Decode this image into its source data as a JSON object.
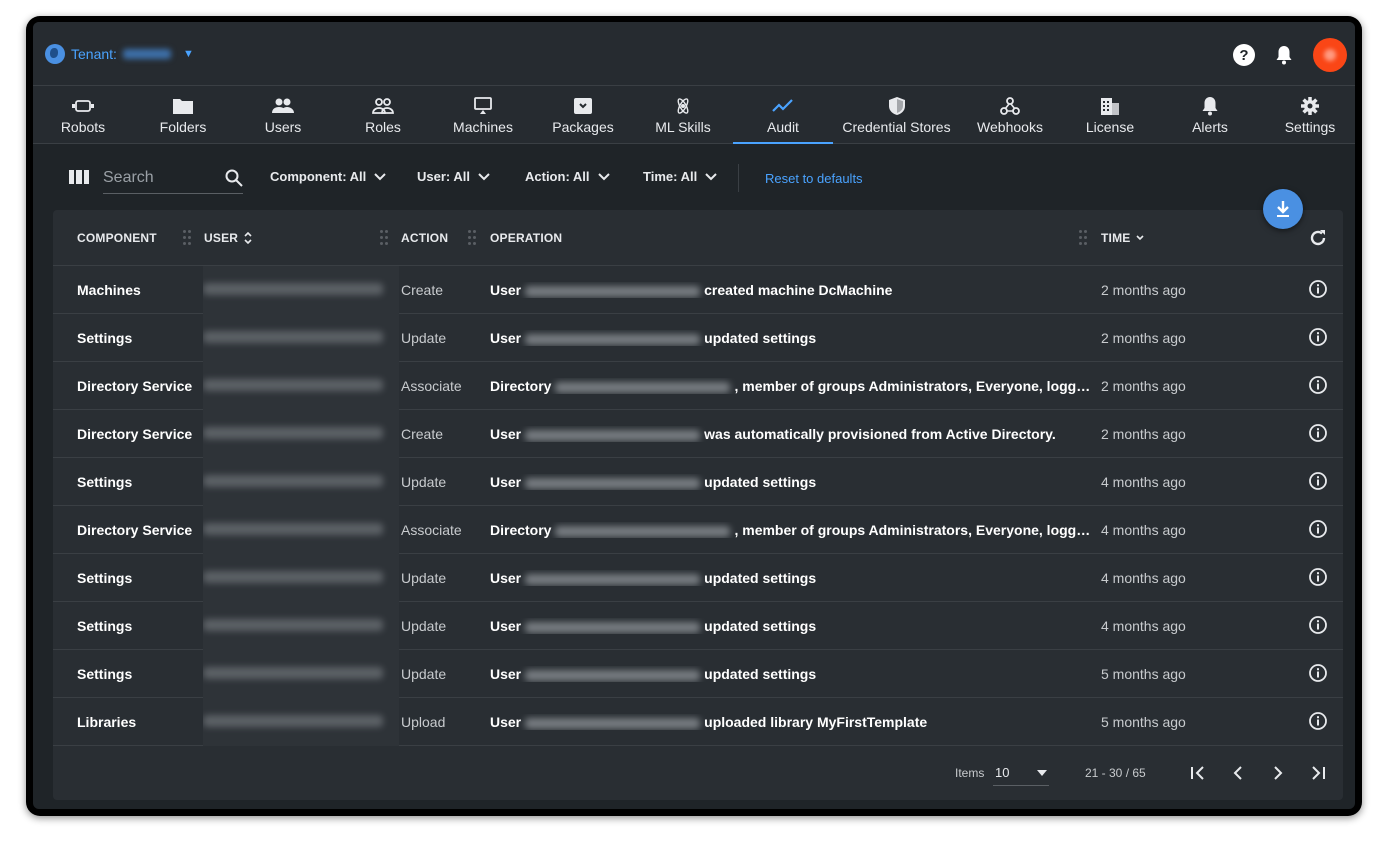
{
  "topbar": {
    "tenant_label": "Tenant:",
    "tenant_name_blurred": "Entities"
  },
  "nav": [
    {
      "label": "Robots",
      "icon": "robot-icon"
    },
    {
      "label": "Folders",
      "icon": "folder-icon"
    },
    {
      "label": "Users",
      "icon": "users-icon"
    },
    {
      "label": "Roles",
      "icon": "roles-icon"
    },
    {
      "label": "Machines",
      "icon": "machine-icon"
    },
    {
      "label": "Packages",
      "icon": "package-icon"
    },
    {
      "label": "ML Skills",
      "icon": "ml-skills-icon"
    },
    {
      "label": "Audit",
      "icon": "audit-icon",
      "active": true
    },
    {
      "label": "Credential Stores",
      "icon": "shield-icon"
    },
    {
      "label": "Webhooks",
      "icon": "webhook-icon"
    },
    {
      "label": "License",
      "icon": "license-icon"
    },
    {
      "label": "Alerts",
      "icon": "bell-icon"
    },
    {
      "label": "Settings",
      "icon": "gear-icon"
    }
  ],
  "filters": {
    "search_placeholder": "Search",
    "component": "Component: All",
    "user": "User: All",
    "action": "Action: All",
    "time": "Time: All",
    "reset": "Reset to defaults"
  },
  "table": {
    "headers": {
      "component": "COMPONENT",
      "user": "USER",
      "action": "ACTION",
      "operation": "OPERATION",
      "time": "TIME"
    },
    "rows": [
      {
        "component": "Machines",
        "action": "Create",
        "op_pre": "User",
        "op_post": "created machine DcMachine",
        "time": "2 months ago"
      },
      {
        "component": "Settings",
        "action": "Update",
        "op_pre": "User",
        "op_post": "updated settings",
        "time": "2 months ago"
      },
      {
        "component": "Directory Service",
        "action": "Associate",
        "op_pre": "Directory",
        "op_post": ", member of groups Administrators, Everyone, logged in…",
        "time": "2 months ago"
      },
      {
        "component": "Directory Service",
        "action": "Create",
        "op_pre": "User",
        "op_post": "was automatically provisioned from Active Directory.",
        "time": "2 months ago"
      },
      {
        "component": "Settings",
        "action": "Update",
        "op_pre": "User",
        "op_post": "updated settings",
        "time": "4 months ago"
      },
      {
        "component": "Directory Service",
        "action": "Associate",
        "op_pre": "Directory",
        "op_post": ", member of groups Administrators, Everyone, logge…",
        "time": "4 months ago"
      },
      {
        "component": "Settings",
        "action": "Update",
        "op_pre": "User",
        "op_post": "updated settings",
        "time": "4 months ago"
      },
      {
        "component": "Settings",
        "action": "Update",
        "op_pre": "User",
        "op_post": "updated settings",
        "time": "4 months ago"
      },
      {
        "component": "Settings",
        "action": "Update",
        "op_pre": "User",
        "op_post": "updated settings",
        "time": "5 months ago"
      },
      {
        "component": "Libraries",
        "action": "Upload",
        "op_pre": "User",
        "op_post": "uploaded library MyFirstTemplate",
        "time": "5 months ago"
      }
    ]
  },
  "pager": {
    "items_label": "Items",
    "page_size": "10",
    "range": "21 - 30 / 65"
  },
  "colors": {
    "accent": "#4aa3ff",
    "avatar": "#fa4616",
    "fab": "#4a90e2"
  }
}
